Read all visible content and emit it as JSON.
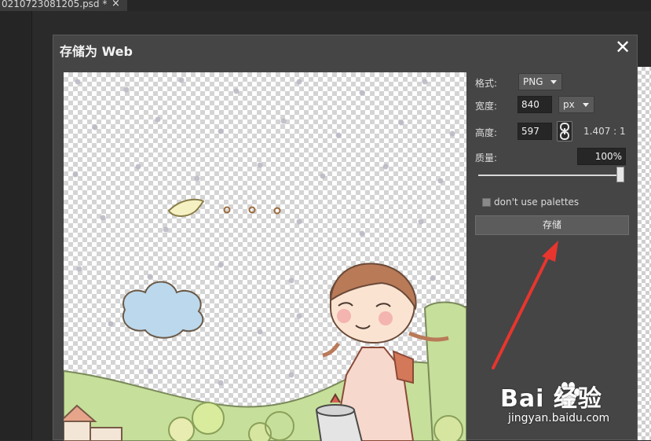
{
  "tab": {
    "filename": "0210723081205.psd *",
    "close_glyph": "×"
  },
  "dialog": {
    "title": "存储为 Web",
    "close_glyph": "✕"
  },
  "settings": {
    "format_label": "格式:",
    "format_value": "PNG",
    "width_label": "宽度:",
    "width_value": "840",
    "unit_value": "px",
    "height_label": "高度:",
    "height_value": "597",
    "ratio": "1.407 : 1",
    "quality_label": "质量:",
    "quality_value": "100%",
    "quality_level": 1.0,
    "palette_label": "don't use palettes",
    "palette_checked": false,
    "save_label": "存储"
  },
  "annotation": {
    "arrow_color": "#e8352e"
  },
  "watermark": {
    "brand": "Bai 经验",
    "url": "jingyan.baidu.com",
    "icon": "paw-icon"
  },
  "icons": {
    "link": "chain-link-icon",
    "dropdown": "chevron-down-icon",
    "close": "close-icon"
  }
}
